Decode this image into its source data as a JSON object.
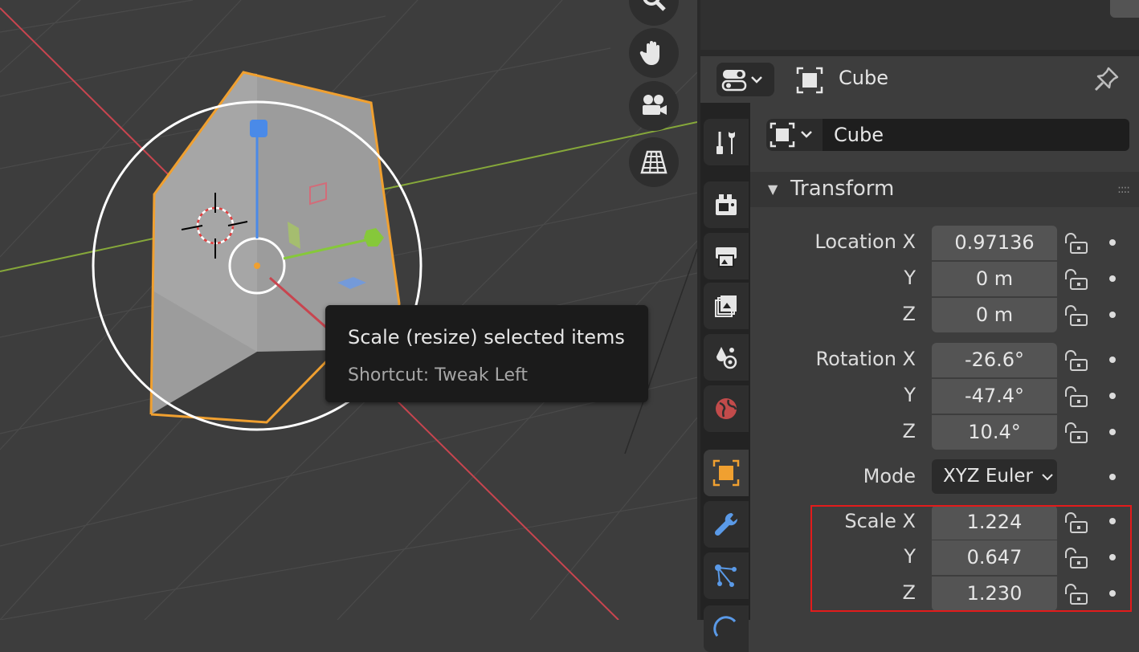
{
  "viewport": {
    "tooltip": {
      "title": "Scale (resize) selected items",
      "shortcut": "Shortcut: Tweak Left"
    },
    "nav_buttons": [
      "zoom-icon",
      "hand-pan-icon",
      "camera-icon",
      "ortho-grid-icon"
    ]
  },
  "properties": {
    "header": {
      "object_name": "Cube"
    },
    "name_field": "Cube",
    "tabs": [
      "tool-icon",
      "render-icon",
      "output-icon",
      "view-layer-icon",
      "scene-icon",
      "world-icon",
      "object-icon",
      "modifier-icon",
      "particles-icon",
      "physics-icon"
    ],
    "active_tab": "object-icon",
    "transform": {
      "title": "Transform",
      "location": {
        "label_x": "Location X",
        "label_y": "Y",
        "label_z": "Z",
        "x": "0.97136",
        "y": "0 m",
        "z": "0 m"
      },
      "rotation": {
        "label_x": "Rotation X",
        "label_y": "Y",
        "label_z": "Z",
        "x": "-26.6°",
        "y": "-47.4°",
        "z": "10.4°"
      },
      "mode": {
        "label": "Mode",
        "value": "XYZ Euler"
      },
      "scale": {
        "label_x": "Scale X",
        "label_y": "Y",
        "label_z": "Z",
        "x": "1.224",
        "y": "0.647",
        "z": "1.230"
      }
    }
  },
  "colors": {
    "selection_outline": "#f0a030",
    "axis_x": "#c8454f",
    "axis_y": "#86a83a",
    "axis_z": "#4a8ae8",
    "highlight_box": "#e31b1b"
  }
}
